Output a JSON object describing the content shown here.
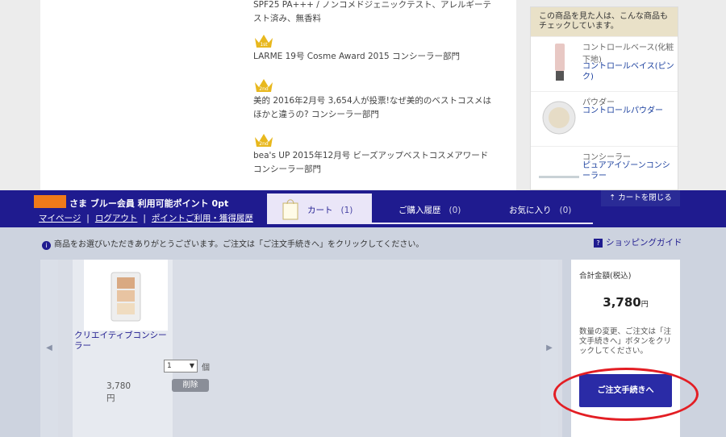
{
  "product": {
    "spf_text": "SPF25 PA+++ / ノンコメドジェニックテスト、アレルギーテスト済み、無香料",
    "awards": [
      {
        "rank_label": "1st",
        "text": "LARME 19号 Cosme Award 2015 コンシーラー部門"
      },
      {
        "rank_label": "2nd",
        "text": "美的 2016年2月号 3,654人が投票!なぜ美的のベストコスメはほかと違うの? コンシーラー部門"
      },
      {
        "rank_label": "2nd",
        "text": "bea's UP 2015年12月号 ビーズアップベストコスメアワード コンシーラー部門"
      }
    ]
  },
  "sidebar": {
    "header": "この商品を見た人は、こんな商品もチェックしています。",
    "items": [
      {
        "category": "コントロールベース(化粧下地)",
        "name": "コントロールベイス(ピンク)"
      },
      {
        "category": "パウダー",
        "name": "コントロールパウダー"
      },
      {
        "category": "コンシーラー",
        "name": "ピュアアイゾーンコンシーラー"
      }
    ],
    "close_cart": "カートを閉じる",
    "close_icon": "upload-arrow-icon"
  },
  "cart_bar": {
    "user_suffix": "さま",
    "member_status": "ブルー会員 利用可能ポイント 0pt",
    "links": [
      "マイページ",
      "ログアウト",
      "ポイントご利用・獲得履歴"
    ],
    "separator": "|",
    "tabs": [
      {
        "label": "カート",
        "count": "(1)"
      },
      {
        "label": "ご購入履歴",
        "count": "(0)"
      },
      {
        "label": "お気に入り",
        "count": "(0)"
      }
    ]
  },
  "cart": {
    "info": "商品をお選びいただきありがとうございます。ご注文は「ご注文手続きへ」をクリックしてください。",
    "guide": "ショッピングガイド",
    "item": {
      "name": "クリエイティブコンシーラー",
      "qty": "1",
      "qty_unit": "個",
      "price": "3,780円",
      "delete": "削除"
    },
    "summary": {
      "label": "合計金額(税込)",
      "amount": "3,780",
      "yen": "円",
      "note": "数量の変更、ご注文は「注文手続きへ」ボタンをクリックしてください。",
      "checkout": "ご注文手続きへ"
    }
  },
  "colors": {
    "nav": "#1f1b8f",
    "accent": "#f07a1a",
    "highlight": "#e31e24"
  }
}
